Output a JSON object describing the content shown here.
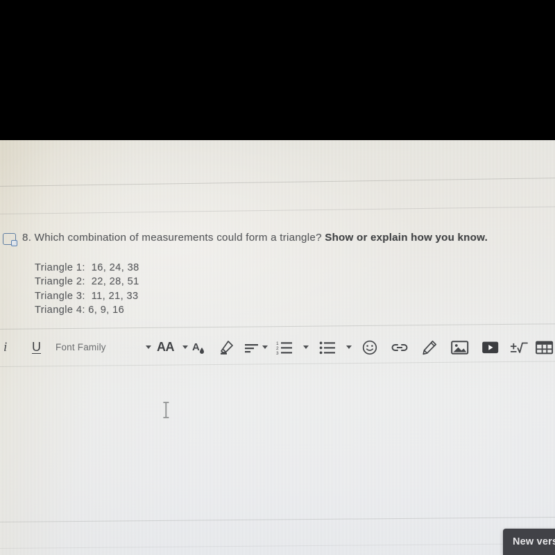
{
  "document": {
    "question_number": "8.",
    "question_text_normal": "8. Which combination of measurements could form a triangle?",
    "question_text_bold": "Show or explain how you know.",
    "triangles": [
      "Triangle 1:  16, 24, 38",
      "Triangle 2:  22, 28, 51",
      "Triangle 3:  11, 21, 33",
      "Triangle 4: 6, 9, 16"
    ]
  },
  "toolbar": {
    "italic_label": "i",
    "underline_label": "U",
    "font_family_label": "Font Family",
    "font_size_label": "AA",
    "icons": {
      "text_color": "text-color-icon",
      "highlighter": "highlighter-icon",
      "align": "align-left-icon",
      "numbered_list": "numbered-list-icon",
      "bullet_list": "bullet-list-icon",
      "emoji": "emoji-icon",
      "link": "link-icon",
      "draw": "pencil-draw-icon",
      "image": "image-icon",
      "video": "video-icon",
      "math": "math-equation-icon",
      "table": "table-icon"
    },
    "math_label": "±√"
  },
  "toast": {
    "message": "New vers"
  },
  "colors": {
    "selection_handle": "#4a6f9c",
    "toolbar_icon": "#4e5053",
    "document_text": "#55575a",
    "toast_background": "#414247",
    "toast_text": "#e6e6e8"
  }
}
